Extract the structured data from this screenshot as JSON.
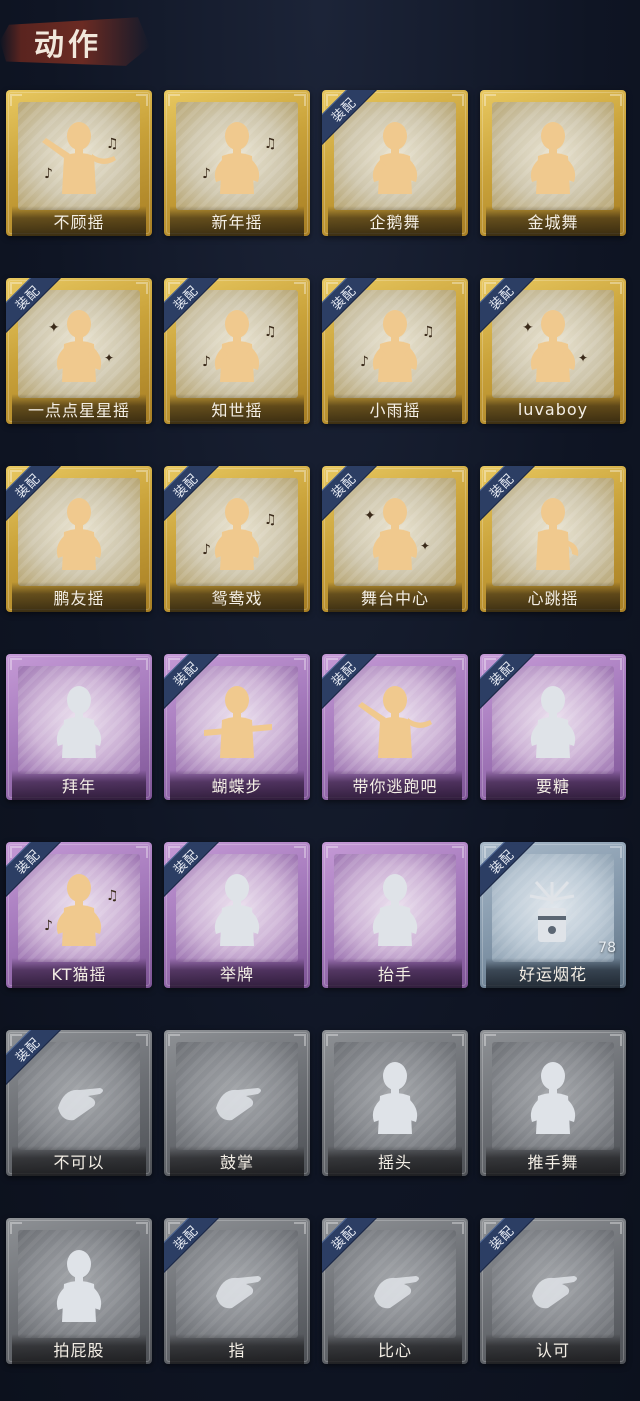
{
  "header": {
    "title": "动作"
  },
  "badge_text": "装配",
  "colors": {
    "gold": "#c9a23a",
    "purple": "#a67bbd",
    "blue": "#8498ab",
    "gray": "#6c6f74",
    "badge": "#2c3e64",
    "figure_gold": "#f0c98e",
    "figure_silver": "#dfe3e8"
  },
  "cards": [
    {
      "label": "不顾摇",
      "rarity": "gold",
      "equipped": false,
      "icon": "dancer-pointing-icon"
    },
    {
      "label": "新年摇",
      "rarity": "gold",
      "equipped": false,
      "icon": "dancer-arm-cross-icon"
    },
    {
      "label": "企鹅舞",
      "rarity": "gold",
      "equipped": true,
      "icon": "dancer-penguin-icon"
    },
    {
      "label": "金城舞",
      "rarity": "gold",
      "equipped": false,
      "icon": "dancer-wave-icon"
    },
    {
      "label": "一点点星星摇",
      "rarity": "gold",
      "equipped": true,
      "icon": "dancer-star-icon"
    },
    {
      "label": "知世摇",
      "rarity": "gold",
      "equipped": true,
      "icon": "dancer-sway-icon"
    },
    {
      "label": "小雨摇",
      "rarity": "gold",
      "equipped": true,
      "icon": "dancer-rain-icon"
    },
    {
      "label": "luvaboy",
      "rarity": "gold",
      "equipped": true,
      "icon": "dancer-lean-icon"
    },
    {
      "label": "鹏友摇",
      "rarity": "gold",
      "equipped": true,
      "icon": "dancer-arm-fold-icon"
    },
    {
      "label": "鸳鸯戏",
      "rarity": "gold",
      "equipped": true,
      "icon": "dancer-music-icon"
    },
    {
      "label": "舞台中心",
      "rarity": "gold",
      "equipped": true,
      "icon": "dancer-center-icon"
    },
    {
      "label": "心跳摇",
      "rarity": "gold",
      "equipped": true,
      "icon": "dancer-heartbeat-icon"
    },
    {
      "label": "拜年",
      "rarity": "purple",
      "equipped": false,
      "icon": "figure-bow-icon"
    },
    {
      "label": "蝴蝶步",
      "rarity": "purple",
      "equipped": true,
      "icon": "dancer-butterfly-icon"
    },
    {
      "label": "带你逃跑吧",
      "rarity": "purple",
      "equipped": true,
      "icon": "dancer-point-run-icon"
    },
    {
      "label": "要糖",
      "rarity": "purple",
      "equipped": true,
      "icon": "figure-ask-icon"
    },
    {
      "label": "KT猫摇",
      "rarity": "purple",
      "equipped": true,
      "icon": "dancer-cat-icon"
    },
    {
      "label": "举牌",
      "rarity": "purple",
      "equipped": true,
      "icon": "figure-sign-icon"
    },
    {
      "label": "抬手",
      "rarity": "purple",
      "equipped": false,
      "icon": "figure-raise-hand-icon"
    },
    {
      "label": "好运烟花",
      "rarity": "blue",
      "equipped": true,
      "icon": "firework-icon",
      "count": "78"
    },
    {
      "label": "不可以",
      "rarity": "gray",
      "equipped": true,
      "icon": "hand-no-icon"
    },
    {
      "label": "鼓掌",
      "rarity": "gray",
      "equipped": false,
      "icon": "hands-clap-icon"
    },
    {
      "label": "摇头",
      "rarity": "gray",
      "equipped": false,
      "icon": "figure-shake-head-icon"
    },
    {
      "label": "推手舞",
      "rarity": "gray",
      "equipped": false,
      "icon": "figure-push-icon"
    },
    {
      "label": "拍屁股",
      "rarity": "gray",
      "equipped": false,
      "icon": "figure-pat-icon"
    },
    {
      "label": "指",
      "rarity": "gray",
      "equipped": true,
      "icon": "hand-point-icon"
    },
    {
      "label": "比心",
      "rarity": "gray",
      "equipped": true,
      "icon": "hand-heart-icon"
    },
    {
      "label": "认可",
      "rarity": "gray",
      "equipped": true,
      "icon": "hand-thumbs-up-icon"
    }
  ]
}
